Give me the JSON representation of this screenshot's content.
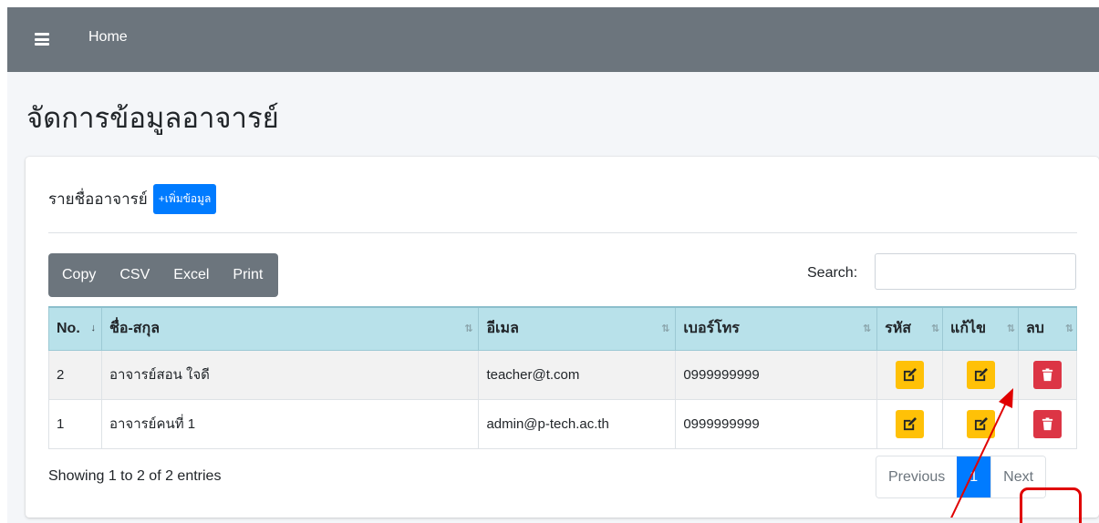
{
  "navbar": {
    "home_label": "Home"
  },
  "page": {
    "title": "จัดการข้อมูลอาจารย์"
  },
  "card": {
    "title": "รายชื่ออาจารย์",
    "add_button": "+เพิ่มข้อมูล"
  },
  "export_buttons": [
    "Copy",
    "CSV",
    "Excel",
    "Print"
  ],
  "search": {
    "label": "Search:",
    "value": ""
  },
  "table": {
    "columns": [
      "No.",
      "ชื่อ-สกุล",
      "อีเมล",
      "เบอร์โทร",
      "รหัส",
      "แก้ไข",
      "ลบ"
    ],
    "rows": [
      {
        "no": "2",
        "name": "อาจารย์สอน ใจดี",
        "email": "teacher@t.com",
        "phone": "0999999999"
      },
      {
        "no": "1",
        "name": "อาจารย์คนที่ 1",
        "email": "admin@p-tech.ac.th",
        "phone": "0999999999"
      }
    ]
  },
  "footer": {
    "info": "Showing 1 to 2 of 2 entries",
    "previous": "Previous",
    "current_page": "1",
    "next": "Next"
  },
  "icons": {
    "menu": "hamburger-icon",
    "edit": "edit-icon",
    "delete": "trash-icon"
  },
  "colors": {
    "navbar": "#6c757d",
    "primary": "#007bff",
    "table_header": "#b8e1ea",
    "warning": "#ffc107",
    "danger": "#dc3545",
    "annotation": "#e00000"
  }
}
